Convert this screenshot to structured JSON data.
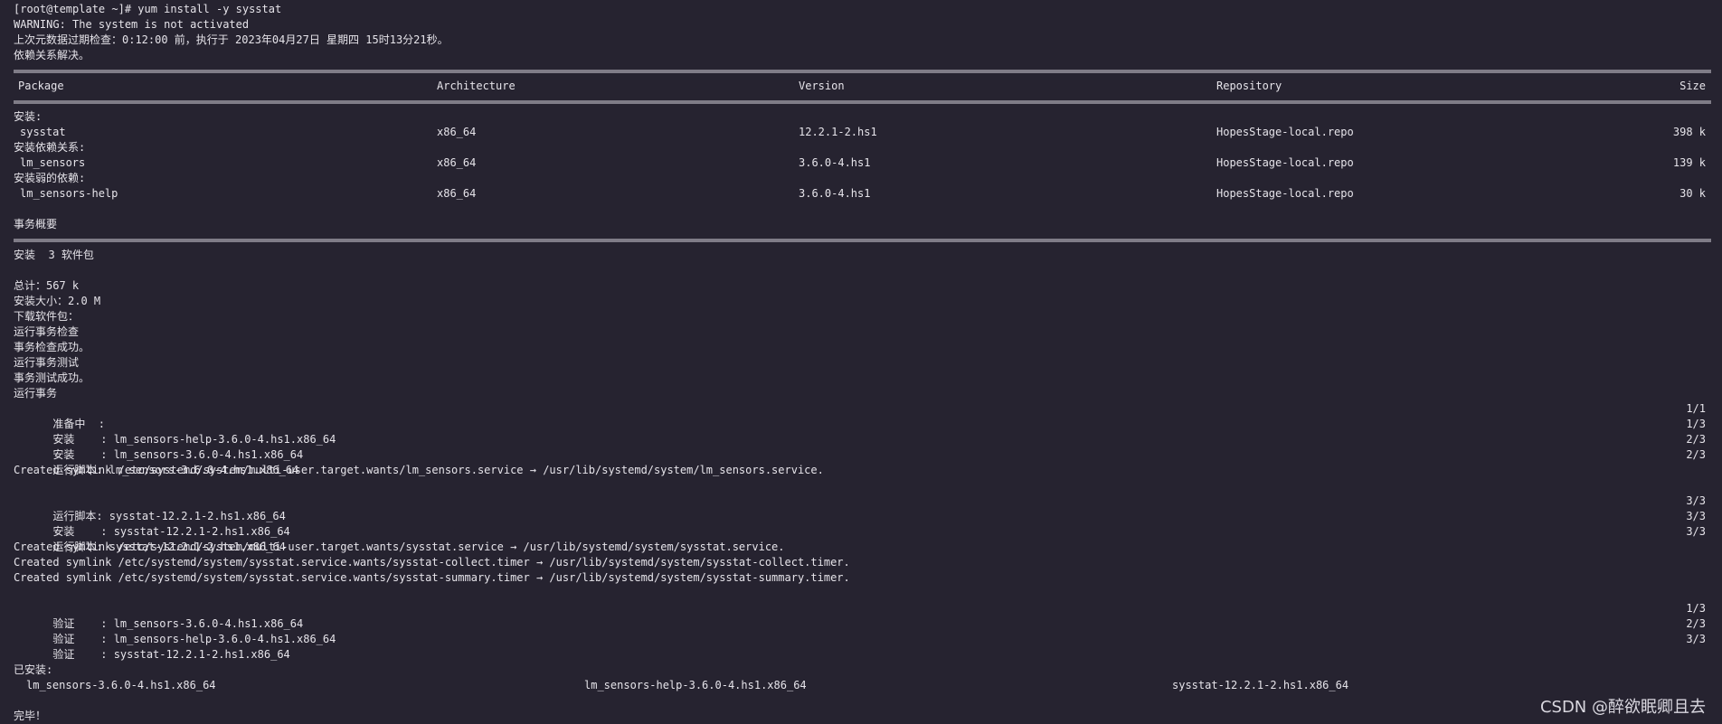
{
  "terminal": {
    "prompt_line": "[root@template ~]# yum install -y sysstat",
    "warning": "WARNING: The system is not activated",
    "metadata_check": "上次元数据过期检查：0:12:00 前，执行于 2023年04月27日 星期四 15时13分21秒。",
    "deps_resolved": "依赖关系解决。",
    "table": {
      "headers": {
        "package": "Package",
        "architecture": "Architecture",
        "version": "Version",
        "repository": "Repository",
        "size": "Size"
      },
      "section_install": "安装:",
      "section_deps": "安装依赖关系:",
      "section_weak": "安装弱的依赖:",
      "rows": [
        {
          "package": "sysstat",
          "arch": "x86_64",
          "version": "12.2.1-2.hs1",
          "repo": "HopesStage-local.repo",
          "size": "398 k"
        },
        {
          "package": "lm_sensors",
          "arch": "x86_64",
          "version": "3.6.0-4.hs1",
          "repo": "HopesStage-local.repo",
          "size": "139 k"
        },
        {
          "package": "lm_sensors-help",
          "arch": "x86_64",
          "version": "3.6.0-4.hs1",
          "repo": "HopesStage-local.repo",
          "size": "30 k"
        }
      ]
    },
    "summary_title": "事务概要",
    "install_count": "安装  3 软件包",
    "total": "总计：567 k",
    "installed_size": "安装大小：2.0 M",
    "downloading": "下载软件包：",
    "steps": [
      "运行事务检查",
      "事务检查成功。",
      "运行事务测试",
      "事务测试成功。",
      "运行事务"
    ],
    "progress_1": [
      {
        "label": "  准备中  :",
        "count": "1/1"
      },
      {
        "label": "  安装    : lm_sensors-help-3.6.0-4.hs1.x86_64",
        "count": "1/3"
      },
      {
        "label": "  安装    : lm_sensors-3.6.0-4.hs1.x86_64",
        "count": "2/3"
      },
      {
        "label": "  运行脚本: lm_sensors-3.6.0-4.hs1.x86_64",
        "count": "2/3"
      }
    ],
    "symlink_1": "Created symlink /etc/systemd/system/multi-user.target.wants/lm_sensors.service → /usr/lib/systemd/system/lm_sensors.service.",
    "progress_2": [
      {
        "label": "  运行脚本: sysstat-12.2.1-2.hs1.x86_64",
        "count": "3/3"
      },
      {
        "label": "  安装    : sysstat-12.2.1-2.hs1.x86_64",
        "count": "3/3"
      },
      {
        "label": "  运行脚本: sysstat-12.2.1-2.hs1.x86_64",
        "count": "3/3"
      }
    ],
    "symlinks_2": [
      "Created symlink /etc/systemd/system/multi-user.target.wants/sysstat.service → /usr/lib/systemd/system/sysstat.service.",
      "Created symlink /etc/systemd/system/sysstat.service.wants/sysstat-collect.timer → /usr/lib/systemd/system/sysstat-collect.timer.",
      "Created symlink /etc/systemd/system/sysstat.service.wants/sysstat-summary.timer → /usr/lib/systemd/system/sysstat-summary.timer."
    ],
    "verify": [
      {
        "label": "  验证    : lm_sensors-3.6.0-4.hs1.x86_64",
        "count": "1/3"
      },
      {
        "label": "  验证    : lm_sensors-help-3.6.0-4.hs1.x86_64",
        "count": "2/3"
      },
      {
        "label": "  验证    : sysstat-12.2.1-2.hs1.x86_64",
        "count": "3/3"
      }
    ],
    "installed_title": "已安装:",
    "installed": [
      "lm_sensors-3.6.0-4.hs1.x86_64",
      "lm_sensors-help-3.6.0-4.hs1.x86_64",
      "sysstat-12.2.1-2.hs1.x86_64"
    ],
    "complete": "完毕！"
  },
  "watermark": "CSDN @醉欲眠卿且去"
}
